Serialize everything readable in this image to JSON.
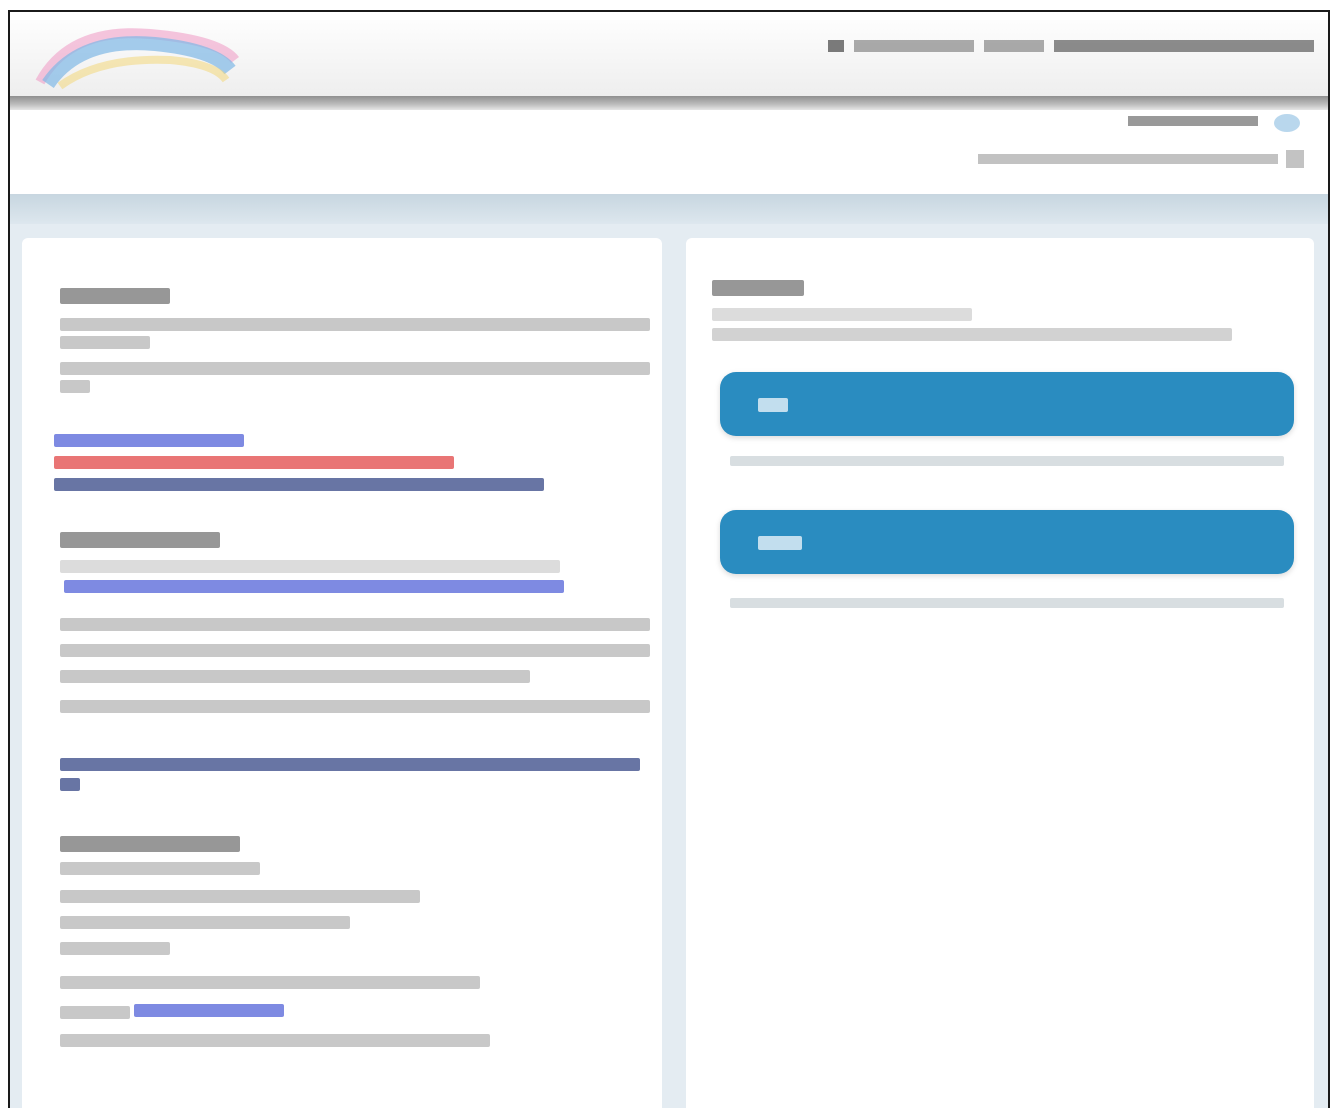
{
  "header": {
    "logo_name": "site-logo",
    "top_links": [],
    "login_label": "",
    "help_label": ""
  },
  "left_panel": {
    "sections": []
  },
  "right_panel": {
    "heading": "",
    "buttons": [
      {
        "label": "",
        "description": ""
      },
      {
        "label": "",
        "description": ""
      }
    ]
  },
  "colors": {
    "button_blue": "#2a8cc0",
    "link_blue": "#4758d6",
    "warning_red": "#e03a3a",
    "band_blue": "#c7d6e0"
  }
}
